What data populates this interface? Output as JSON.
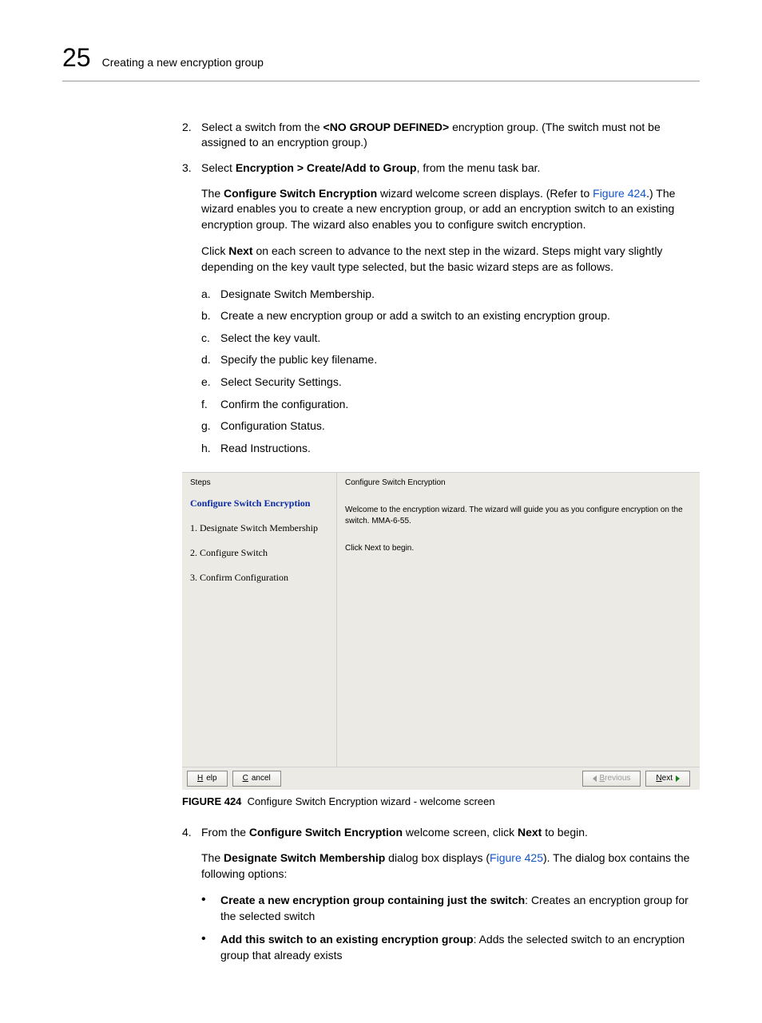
{
  "header": {
    "chapter_number": "25",
    "chapter_title": "Creating a new encryption group"
  },
  "step2": {
    "num": "2.",
    "pre": "Select a switch from the ",
    "bold": "<NO GROUP DEFINED>",
    "post": " encryption group. (The switch must not be assigned to an encryption group.)"
  },
  "step3": {
    "num": "3.",
    "pre": "Select ",
    "bold": "Encryption > Create/Add to Group",
    "post": ", from the menu task bar.",
    "p1_pre": "The ",
    "p1_bold": "Configure Switch Encryption",
    "p1_mid": " wizard welcome screen displays. (Refer to ",
    "p1_link": "Figure 424",
    "p1_post": ".) The wizard enables you to create a new encryption group, or add an encryption switch to an existing encryption group. The wizard also enables you to configure switch encryption.",
    "p2_pre": "Click ",
    "p2_bold": "Next",
    "p2_post": " on each screen to advance to the next step in the wizard. Steps might vary slightly depending on the key vault type selected, but the basic wizard steps are as follows.",
    "alpha": [
      {
        "m": "a.",
        "t": "Designate Switch Membership."
      },
      {
        "m": "b.",
        "t": "Create a new encryption group or add a switch to an existing encryption group."
      },
      {
        "m": "c.",
        "t": "Select the key vault."
      },
      {
        "m": "d.",
        "t": "Specify the public key filename."
      },
      {
        "m": "e.",
        "t": "Select Security Settings."
      },
      {
        "m": "f.",
        "t": "Confirm the configuration."
      },
      {
        "m": "g.",
        "t": "Configuration Status."
      },
      {
        "m": "h.",
        "t": "Read Instructions."
      }
    ]
  },
  "wizard": {
    "left_heading": "Steps",
    "step_title": "Configure Switch Encryption",
    "steps": [
      "1. Designate Switch Membership",
      "2. Configure Switch",
      "3. Confirm Configuration"
    ],
    "right_title": "Configure Switch Encryption",
    "right_p1": "Welcome to the encryption wizard. The wizard will guide you as you configure encryption on the switch. MMA-6-55.",
    "right_p2": "Click Next to begin.",
    "buttons": {
      "help_u": "H",
      "help_r": "elp",
      "cancel_u": "C",
      "cancel_r": "ancel",
      "prev_u": "B",
      "prev_pre": "",
      "prev_post": "revious",
      "next_u": "N",
      "next_r": "ext"
    }
  },
  "figure": {
    "label": "FIGURE 424",
    "caption": "Configure Switch Encryption wizard - welcome screen"
  },
  "step4": {
    "num": "4.",
    "pre": "From the ",
    "bold1": "Configure Switch Encryption",
    "mid": " welcome screen, click ",
    "bold2": "Next",
    "post": " to begin.",
    "p1_pre": "The ",
    "p1_bold": "Designate Switch Membership",
    "p1_mid": " dialog box displays (",
    "p1_link": "Figure 425",
    "p1_post": "). The dialog box contains the following options:",
    "bullets": [
      {
        "bold": "Create a new encryption group containing just the switch",
        "rest": ": Creates an encryption group for the selected switch"
      },
      {
        "bold": "Add this switch to an existing encryption group",
        "rest": ": Adds the selected switch to an encryption group that already exists"
      }
    ]
  }
}
